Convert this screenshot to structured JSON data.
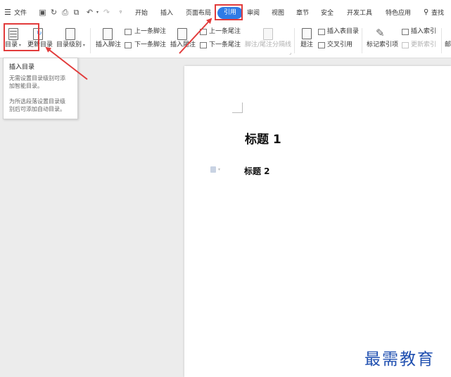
{
  "menubar": {
    "file_label": "文件",
    "tabs": [
      {
        "label": "开始"
      },
      {
        "label": "插入"
      },
      {
        "label": "页面布局"
      },
      {
        "label": "引用"
      },
      {
        "label": "审阅"
      },
      {
        "label": "视图"
      },
      {
        "label": "章节"
      },
      {
        "label": "安全"
      },
      {
        "label": "开发工具"
      },
      {
        "label": "特色应用"
      }
    ],
    "search_label": "查找",
    "active_tab": "引用"
  },
  "ribbon": {
    "toc": "目录",
    "update_toc": "更新目录",
    "toc_level": "目录级别",
    "insert_footnote": "插入脚注",
    "prev_footnote": "上一条脚注",
    "next_footnote": "下一条脚注",
    "insert_endnote": "插入尾注",
    "prev_endnote": "上一条尾注",
    "next_endnote": "下一条尾注",
    "footnote_separator": "脚注/尾注分隔线",
    "caption": "题注",
    "insert_table_of_figures": "插入表目录",
    "cross_reference": "交叉引用",
    "mark_index_entry": "标记索引项",
    "insert_index": "插入索引",
    "update_index": "更新索引",
    "cut_label": "邮"
  },
  "tooltip": {
    "title": "插入目录",
    "line1": "无需设置目录级别可添",
    "line2": "加智能目录。",
    "line3": "为所选段落设置目录级",
    "line4": "别后可添加自动目录。"
  },
  "document": {
    "heading1": "标题 1",
    "heading2": "标题 2"
  },
  "watermark": "最需教育",
  "colors": {
    "accent": "#2f7be6",
    "highlight": "#e23b3b",
    "watermark": "#1f4fb0"
  }
}
